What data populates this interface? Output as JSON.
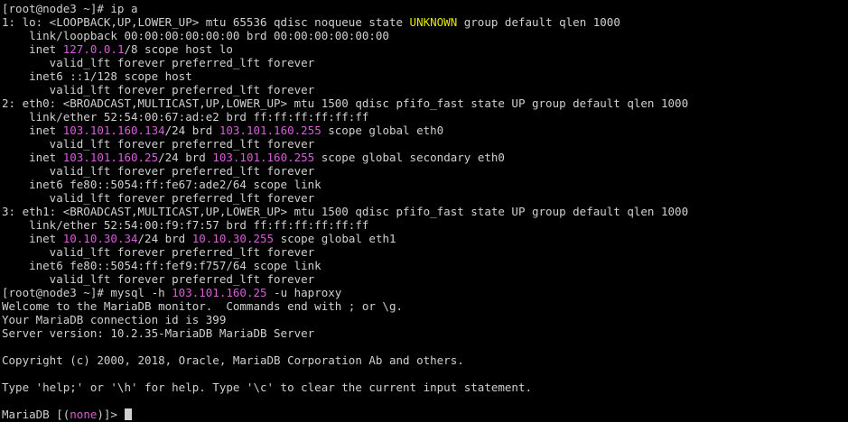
{
  "terminal": {
    "colors": {
      "background": "#000000",
      "normal": "#d0d0d0",
      "magenta": "#d75fd7",
      "yellow": "#e5e500"
    },
    "lines": [
      [
        [
          "normal",
          "[root@node3 ~]# ip a"
        ]
      ],
      [
        [
          "normal",
          "1: lo: <LOOPBACK,UP,LOWER_UP> mtu 65536 qdisc noqueue state "
        ],
        [
          "yellow",
          "UNKNOWN"
        ],
        [
          "normal",
          " group default qlen 1000"
        ]
      ],
      [
        [
          "normal",
          "    link/loopback 00:00:00:00:00:00 brd 00:00:00:00:00:00"
        ]
      ],
      [
        [
          "normal",
          "    inet "
        ],
        [
          "magenta",
          "127.0.0.1"
        ],
        [
          "normal",
          "/8 scope host lo"
        ]
      ],
      [
        [
          "normal",
          "       valid_lft forever preferred_lft forever"
        ]
      ],
      [
        [
          "normal",
          "    inet6 ::1/128 scope host"
        ]
      ],
      [
        [
          "normal",
          "       valid_lft forever preferred_lft forever"
        ]
      ],
      [
        [
          "normal",
          "2: eth0: <BROADCAST,MULTICAST,UP,LOWER_UP> mtu 1500 qdisc pfifo_fast state UP group default qlen 1000"
        ]
      ],
      [
        [
          "normal",
          "    link/ether 52:54:00:67:ad:e2 brd ff:ff:ff:ff:ff:ff"
        ]
      ],
      [
        [
          "normal",
          "    inet "
        ],
        [
          "magenta",
          "103.101.160.134"
        ],
        [
          "normal",
          "/24 brd "
        ],
        [
          "magenta",
          "103.101.160.255"
        ],
        [
          "normal",
          " scope global eth0"
        ]
      ],
      [
        [
          "normal",
          "       valid_lft forever preferred_lft forever"
        ]
      ],
      [
        [
          "normal",
          "    inet "
        ],
        [
          "magenta",
          "103.101.160.25"
        ],
        [
          "normal",
          "/24 brd "
        ],
        [
          "magenta",
          "103.101.160.255"
        ],
        [
          "normal",
          " scope global secondary eth0"
        ]
      ],
      [
        [
          "normal",
          "       valid_lft forever preferred_lft forever"
        ]
      ],
      [
        [
          "normal",
          "    inet6 fe80::5054:ff:fe67:ade2/64 scope link"
        ]
      ],
      [
        [
          "normal",
          "       valid_lft forever preferred_lft forever"
        ]
      ],
      [
        [
          "normal",
          "3: eth1: <BROADCAST,MULTICAST,UP,LOWER_UP> mtu 1500 qdisc pfifo_fast state UP group default qlen 1000"
        ]
      ],
      [
        [
          "normal",
          "    link/ether 52:54:00:f9:f7:57 brd ff:ff:ff:ff:ff:ff"
        ]
      ],
      [
        [
          "normal",
          "    inet "
        ],
        [
          "magenta",
          "10.10.30.34"
        ],
        [
          "normal",
          "/24 brd "
        ],
        [
          "magenta",
          "10.10.30.255"
        ],
        [
          "normal",
          " scope global eth1"
        ]
      ],
      [
        [
          "normal",
          "       valid_lft forever preferred_lft forever"
        ]
      ],
      [
        [
          "normal",
          "    inet6 fe80::5054:ff:fef9:f757/64 scope link"
        ]
      ],
      [
        [
          "normal",
          "       valid_lft forever preferred_lft forever"
        ]
      ],
      [
        [
          "normal",
          "[root@node3 ~]# mysql -h "
        ],
        [
          "magenta",
          "103.101.160.25"
        ],
        [
          "normal",
          " -u haproxy"
        ]
      ],
      [
        [
          "normal",
          "Welcome to the MariaDB monitor.  Commands end with ; or \\g."
        ]
      ],
      [
        [
          "normal",
          "Your MariaDB connection id is 399"
        ]
      ],
      [
        [
          "normal",
          "Server version: 10.2.35-MariaDB MariaDB Server"
        ]
      ],
      [
        [
          "normal",
          ""
        ]
      ],
      [
        [
          "normal",
          "Copyright (c) 2000, 2018, Oracle, MariaDB Corporation Ab and others."
        ]
      ],
      [
        [
          "normal",
          ""
        ]
      ],
      [
        [
          "normal",
          "Type 'help;' or '\\h' for help. Type '\\c' to clear the current input statement."
        ]
      ],
      [
        [
          "normal",
          ""
        ]
      ],
      [
        [
          "normal",
          "MariaDB [("
        ],
        [
          "magenta",
          "none"
        ],
        [
          "normal",
          ")]> "
        ]
      ]
    ]
  }
}
